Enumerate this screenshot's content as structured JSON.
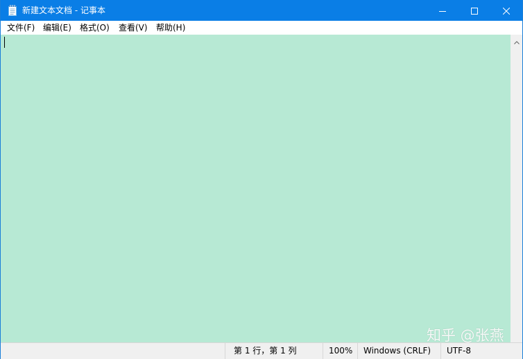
{
  "window": {
    "title": "新建文本文档 - 记事本",
    "controls": {
      "minimize_icon": "minimize-icon",
      "maximize_icon": "maximize-icon",
      "close_icon": "close-icon"
    }
  },
  "menu": {
    "items": [
      {
        "label": "文件(F)"
      },
      {
        "label": "编辑(E)"
      },
      {
        "label": "格式(O)"
      },
      {
        "label": "查看(V)"
      },
      {
        "label": "帮助(H)"
      }
    ]
  },
  "editor": {
    "content": "",
    "background": "#b7e9d4"
  },
  "status": {
    "position": "第 1 行，第 1 列",
    "zoom": "100%",
    "line_ending": "Windows (CRLF)",
    "encoding": "UTF-8"
  },
  "watermark": {
    "text": "知乎 @张燕"
  },
  "colors": {
    "titlebar": "#0a7ee6",
    "editor_bg": "#b7e9d4",
    "statusbar": "#f0f0f0"
  }
}
